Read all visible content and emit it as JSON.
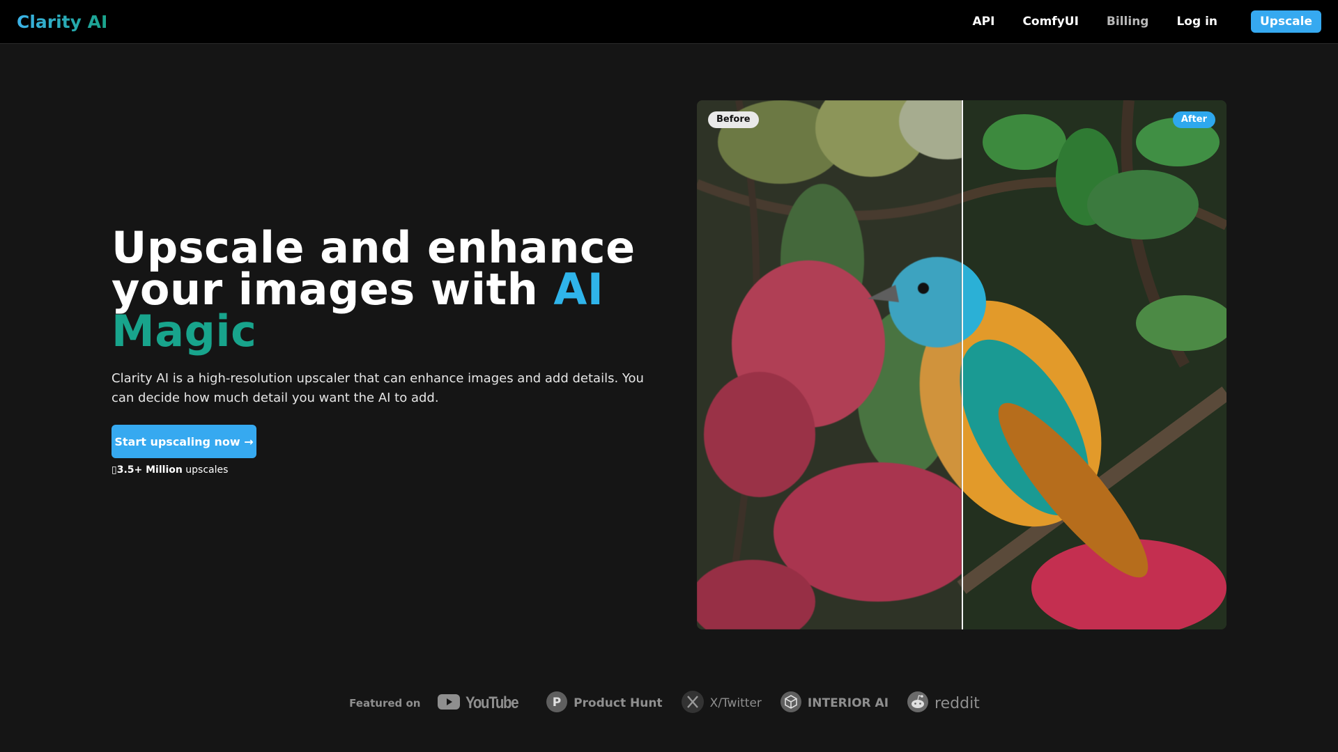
{
  "nav": {
    "logo": "Clarity AI",
    "links": [
      {
        "label": "API"
      },
      {
        "label": "ComfyUI"
      },
      {
        "label": "Billing"
      },
      {
        "label": "Log in"
      }
    ],
    "upscale_button": "Upscale"
  },
  "hero": {
    "title_line1": "Upscale and enhance",
    "title_line2": "your images with",
    "title_ai": "AI",
    "title_magic": "Magic",
    "description": "Clarity AI is a high-resolution upscaler that can enhance images and add details. You can decide how much detail you want the AI to add.",
    "cta_label": "Start upscaling now →",
    "stats_icon": "▯",
    "stats_count": "3.5+ Million",
    "stats_suffix": " upscales"
  },
  "comparison": {
    "before_label": "Before",
    "after_label": "After",
    "slider_position": 0.5
  },
  "featured": {
    "label": "Featured on",
    "brands": [
      {
        "name": "YouTube",
        "icon": "play-icon"
      },
      {
        "name": "Product Hunt",
        "icon": "product-hunt-icon"
      },
      {
        "name": "X/Twitter",
        "icon": "x-logo-icon"
      },
      {
        "name": "INTERIOR AI",
        "icon": "cube-icon"
      },
      {
        "name": "reddit",
        "icon": "reddit-alien-icon"
      }
    ]
  },
  "colors": {
    "accent_blue": "#36a9f0",
    "accent_teal": "#18a48c",
    "background": "#151515",
    "nav_background": "#000000"
  }
}
